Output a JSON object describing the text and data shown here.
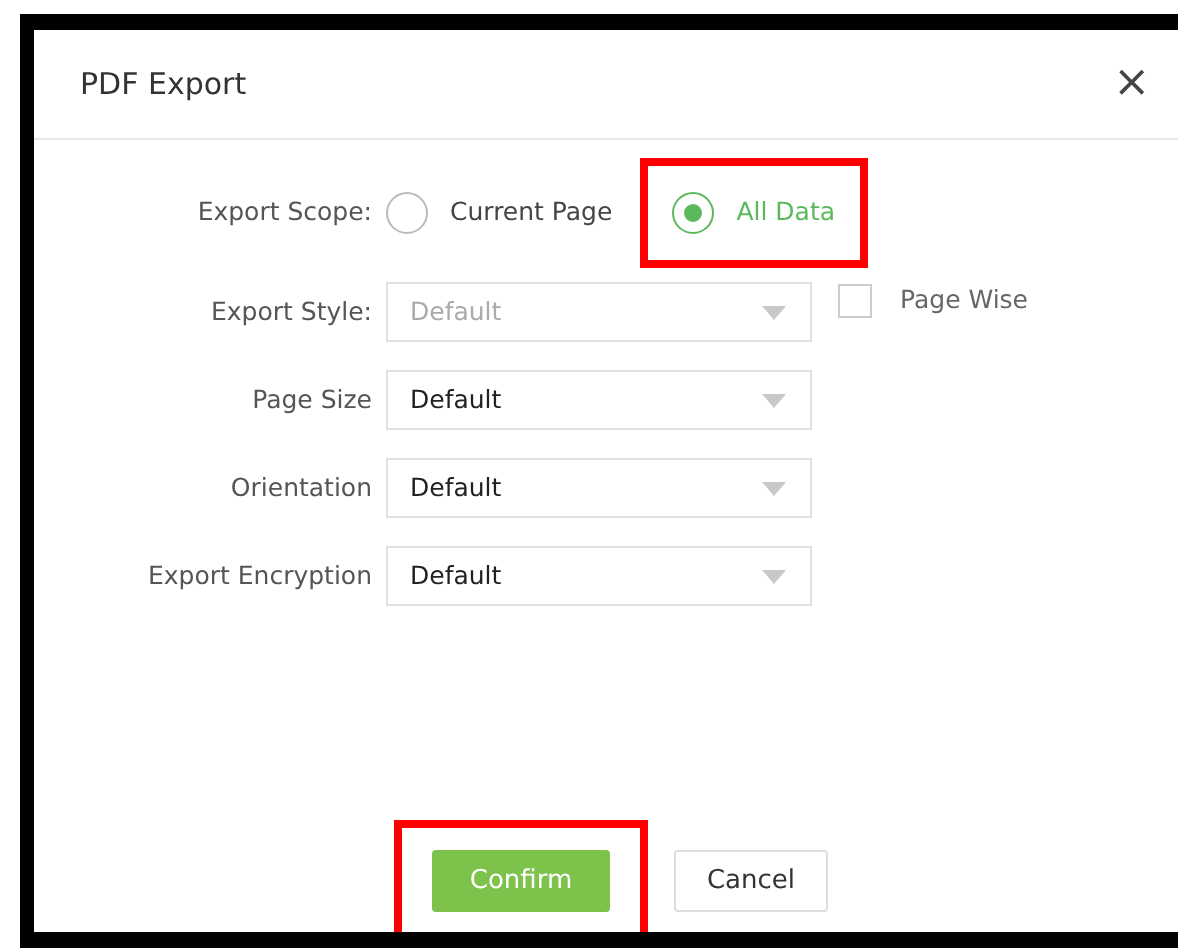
{
  "dialog": {
    "title": "PDF Export",
    "close": "×"
  },
  "export_scope": {
    "label": "Export Scope:",
    "options": [
      {
        "label": "Current Page",
        "selected": false,
        "highlighted": false
      },
      {
        "label": "All Data",
        "selected": true,
        "highlighted": true
      }
    ]
  },
  "fields": [
    {
      "label": "Export Style:",
      "value": "Default",
      "disabled": true
    },
    {
      "label": "Page Size",
      "value": "Default",
      "disabled": false
    },
    {
      "label": "Orientation",
      "value": "Default",
      "disabled": false
    },
    {
      "label": "Export Encryption",
      "value": "Default",
      "disabled": false
    }
  ],
  "page_wise": {
    "label": "Page Wise",
    "checked": false
  },
  "buttons": [
    {
      "label": "Confirm",
      "kind": "primary",
      "highlighted": true
    },
    {
      "label": "Cancel",
      "kind": "secondary",
      "highlighted": false
    }
  ]
}
